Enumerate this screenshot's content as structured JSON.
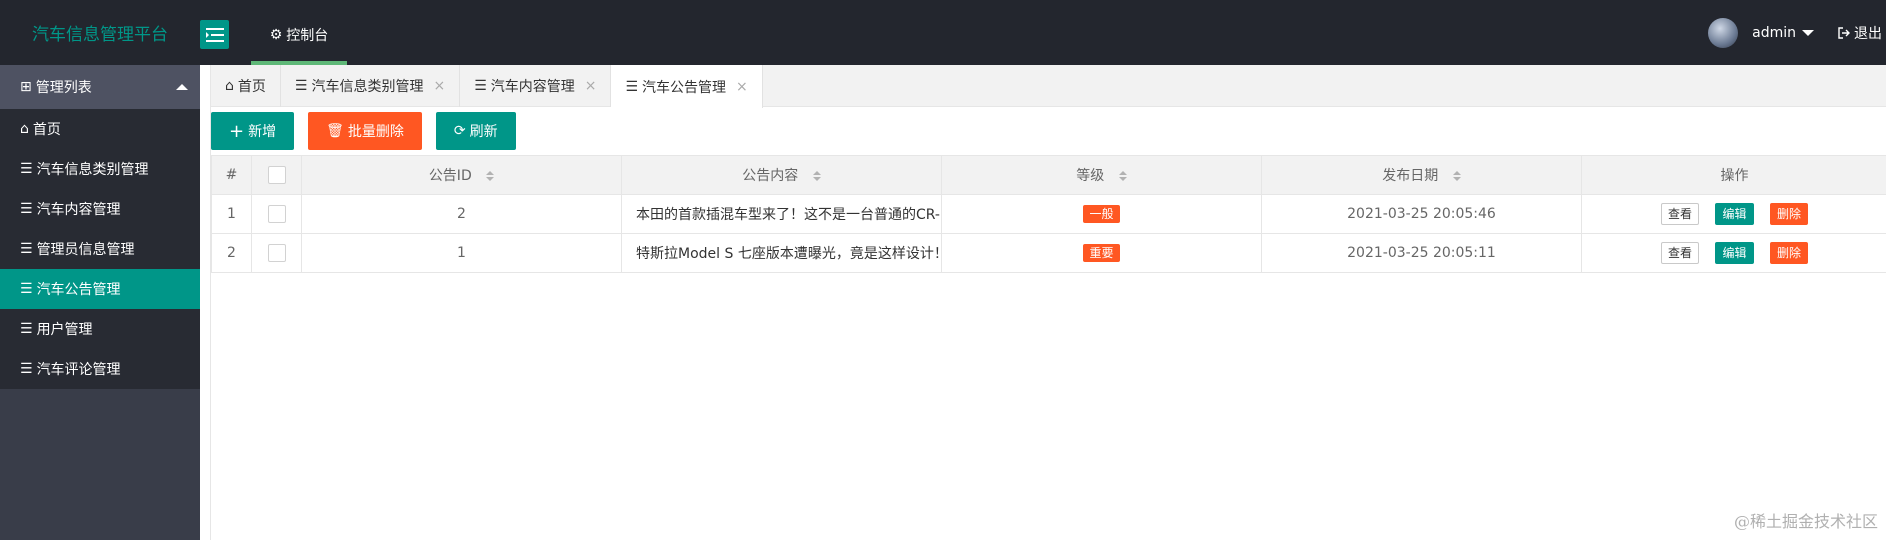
{
  "app": {
    "title": "汽车信息管理平台"
  },
  "topnav": {
    "console_label": "控制台"
  },
  "user": {
    "name": "admin",
    "logout_label": "退出"
  },
  "sidebar": {
    "header": "管理列表",
    "items": [
      {
        "label": "首页"
      },
      {
        "label": "汽车信息类别管理"
      },
      {
        "label": "汽车内容管理"
      },
      {
        "label": "管理员信息管理"
      },
      {
        "label": "汽车公告管理"
      },
      {
        "label": "用户管理"
      },
      {
        "label": "汽车评论管理"
      }
    ]
  },
  "tabs": [
    {
      "label": "首页"
    },
    {
      "label": "汽车信息类别管理"
    },
    {
      "label": "汽车内容管理"
    },
    {
      "label": "汽车公告管理"
    }
  ],
  "toolbar": {
    "add": "新增",
    "batch_delete": "批量删除",
    "refresh": "刷新"
  },
  "table": {
    "headers": [
      "#",
      "",
      "公告ID",
      "公告内容",
      "等级",
      "发布日期",
      "操作"
    ],
    "rows": [
      {
        "index": "1",
        "id": "2",
        "content": "本田的首款插混车型来了！这不是一台普通的CR-",
        "level": "一般",
        "date": "2021-03-25 20:05:46"
      },
      {
        "index": "2",
        "id": "1",
        "content": "特斯拉Model S 七座版本遭曝光，竟是这样设计！",
        "level": "重要",
        "date": "2021-03-25 20:05:11"
      }
    ],
    "actions": {
      "view": "查看",
      "edit": "编辑",
      "delete": "删除"
    }
  },
  "watermark": "@稀土掘金技术社区",
  "colors": {
    "accent": "#009688",
    "danger": "#ff5722",
    "topbar": "#23262e",
    "sidebar": "#393d49"
  }
}
